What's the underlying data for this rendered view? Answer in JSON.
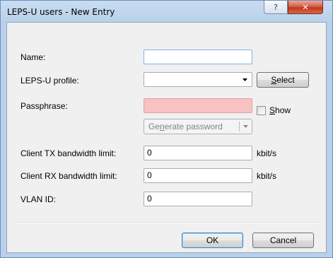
{
  "window": {
    "title": "LEPS-U users - New Entry",
    "help_glyph": "?",
    "close_glyph": "✕"
  },
  "form": {
    "name": {
      "label": "Name:",
      "value": ""
    },
    "profile": {
      "label": "LEPS-U profile:",
      "value": "",
      "select_button": {
        "accel": "S",
        "rest": "elect"
      }
    },
    "passphrase": {
      "label": "Passphrase:",
      "value": "",
      "show_label": {
        "accel": "S",
        "rest": "how"
      },
      "show_checked": false
    },
    "generate_button": {
      "pre": "Ge",
      "accel": "n",
      "post": "erate password"
    },
    "tx": {
      "label": "Client TX bandwidth limit:",
      "value": "0",
      "unit": "kbit/s"
    },
    "rx": {
      "label": "Client RX bandwidth limit:",
      "value": "0",
      "unit": "kbit/s"
    },
    "vlan": {
      "label": "VLAN ID:",
      "value": "0"
    }
  },
  "buttons": {
    "ok": "OK",
    "cancel": "Cancel"
  },
  "colors": {
    "titlebar": "#b9d1ea",
    "close_button": "#c1361c",
    "passphrase_field": "#f8c2c2",
    "client_area": "#f0f0f0"
  }
}
